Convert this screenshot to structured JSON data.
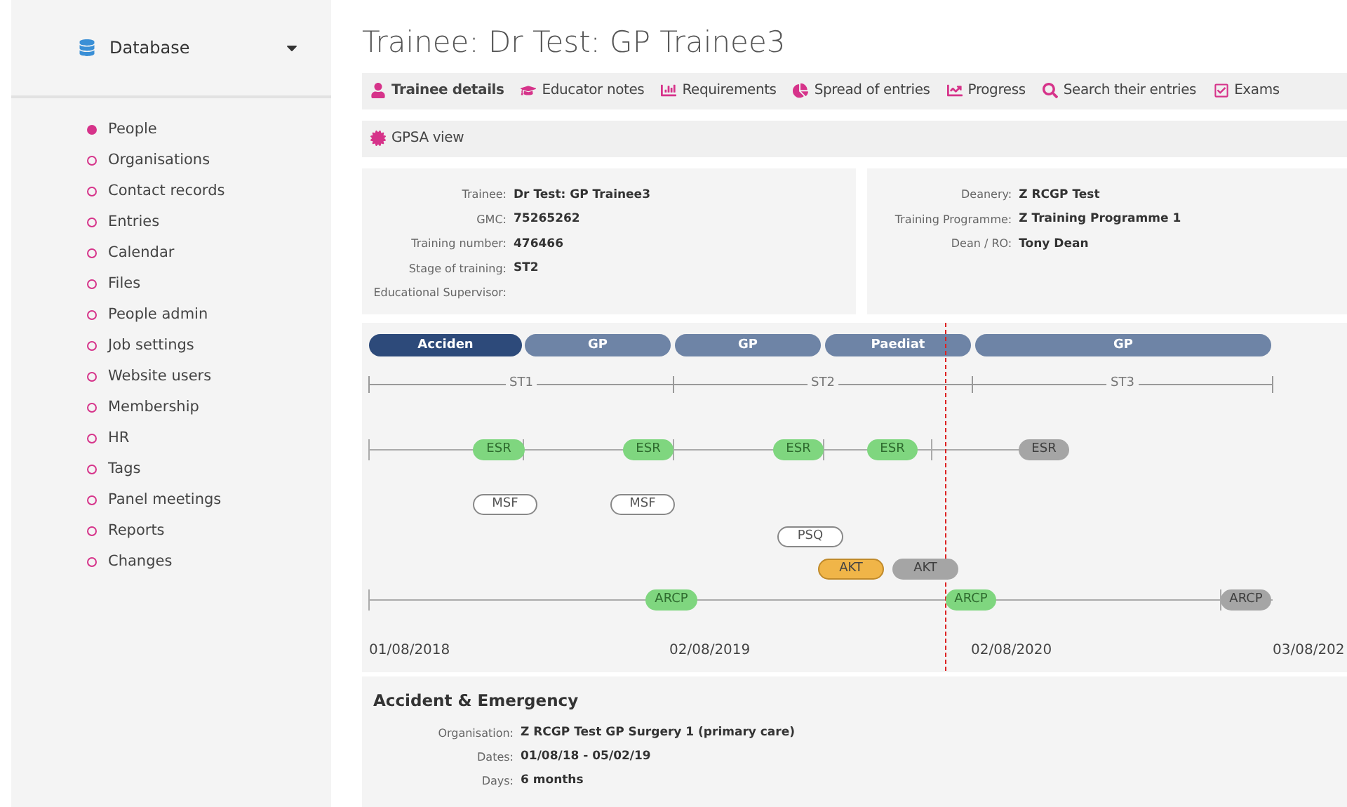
{
  "sidebar": {
    "title": "Database",
    "items": [
      {
        "label": "People",
        "selected": true
      },
      {
        "label": "Organisations",
        "selected": false
      },
      {
        "label": "Contact records",
        "selected": false
      },
      {
        "label": "Entries",
        "selected": false
      },
      {
        "label": "Calendar",
        "selected": false
      },
      {
        "label": "Files",
        "selected": false
      },
      {
        "label": "People admin",
        "selected": false
      },
      {
        "label": "Job settings",
        "selected": false
      },
      {
        "label": "Website users",
        "selected": false
      },
      {
        "label": "Membership",
        "selected": false
      },
      {
        "label": "HR",
        "selected": false
      },
      {
        "label": "Tags",
        "selected": false
      },
      {
        "label": "Panel meetings",
        "selected": false
      },
      {
        "label": "Reports",
        "selected": false
      },
      {
        "label": "Changes",
        "selected": false
      }
    ]
  },
  "page_title": "Trainee: Dr Test: GP Trainee3",
  "tabs": [
    {
      "label": "Trainee details",
      "selected": true
    },
    {
      "label": "Educator notes",
      "selected": false
    },
    {
      "label": "Requirements",
      "selected": false
    },
    {
      "label": "Spread of entries",
      "selected": false
    },
    {
      "label": "Progress",
      "selected": false
    },
    {
      "label": "Search their entries",
      "selected": false
    },
    {
      "label": "Exams",
      "selected": false
    }
  ],
  "secondary_tab": {
    "label": "GPSA view"
  },
  "details_left": [
    {
      "label": "Trainee:",
      "value": "Dr Test: GP Trainee3"
    },
    {
      "label": "GMC:",
      "value": "75265262"
    },
    {
      "label": "Training number:",
      "value": "476466"
    },
    {
      "label": "Stage of training:",
      "value": "ST2"
    },
    {
      "label": "Educational Supervisor:"
    }
  ],
  "details_right": [
    {
      "label": "Deanery:",
      "value": "Z RCGP Test"
    },
    {
      "label": "Training Programme:",
      "value": "Z Training Programme 1"
    },
    {
      "label": "Dean / RO:",
      "value": "Tony Dean"
    }
  ],
  "timeline": {
    "placements": [
      {
        "label": "Acciden",
        "selected": true
      },
      {
        "label": "GP",
        "selected": false
      },
      {
        "label": "GP",
        "selected": false
      },
      {
        "label": "Paediat",
        "selected": false
      },
      {
        "label": "GP",
        "selected": false
      }
    ],
    "stages": [
      "ST1",
      "ST2",
      "ST3"
    ],
    "rows": [
      {
        "kind": "line",
        "items": [
          {
            "label": "ESR",
            "kind": "done"
          },
          {
            "label": "ESR",
            "kind": "done"
          },
          {
            "label": "ESR",
            "kind": "done"
          },
          {
            "label": "ESR",
            "kind": "done"
          },
          {
            "label": "ESR",
            "kind": "future"
          }
        ]
      },
      {
        "kind": "free",
        "items": [
          {
            "label": "MSF",
            "kind": "open"
          },
          {
            "label": "MSF",
            "kind": "open"
          }
        ]
      },
      {
        "kind": "free",
        "items": [
          {
            "label": "PSQ",
            "kind": "open"
          }
        ]
      },
      {
        "kind": "free",
        "items": [
          {
            "label": "AKT",
            "kind": "pending"
          },
          {
            "label": "AKT",
            "kind": "future"
          }
        ]
      },
      {
        "kind": "line",
        "items": [
          {
            "label": "ARCP",
            "kind": "done"
          },
          {
            "label": "ARCP",
            "kind": "done"
          },
          {
            "label": "ARCP",
            "kind": "future"
          }
        ]
      }
    ],
    "dates": [
      "01/08/2018",
      "02/08/2019",
      "02/08/2020",
      "03/08/202"
    ]
  },
  "placement_detail": {
    "title": "Accident & Emergency",
    "fields": [
      {
        "label": "Organisation:",
        "value": "Z RCGP Test GP Surgery 1 (primary care)"
      },
      {
        "label": "Dates:",
        "value": "01/08/18 - 05/02/19"
      },
      {
        "label": "Days:",
        "value": "6 months"
      }
    ]
  }
}
